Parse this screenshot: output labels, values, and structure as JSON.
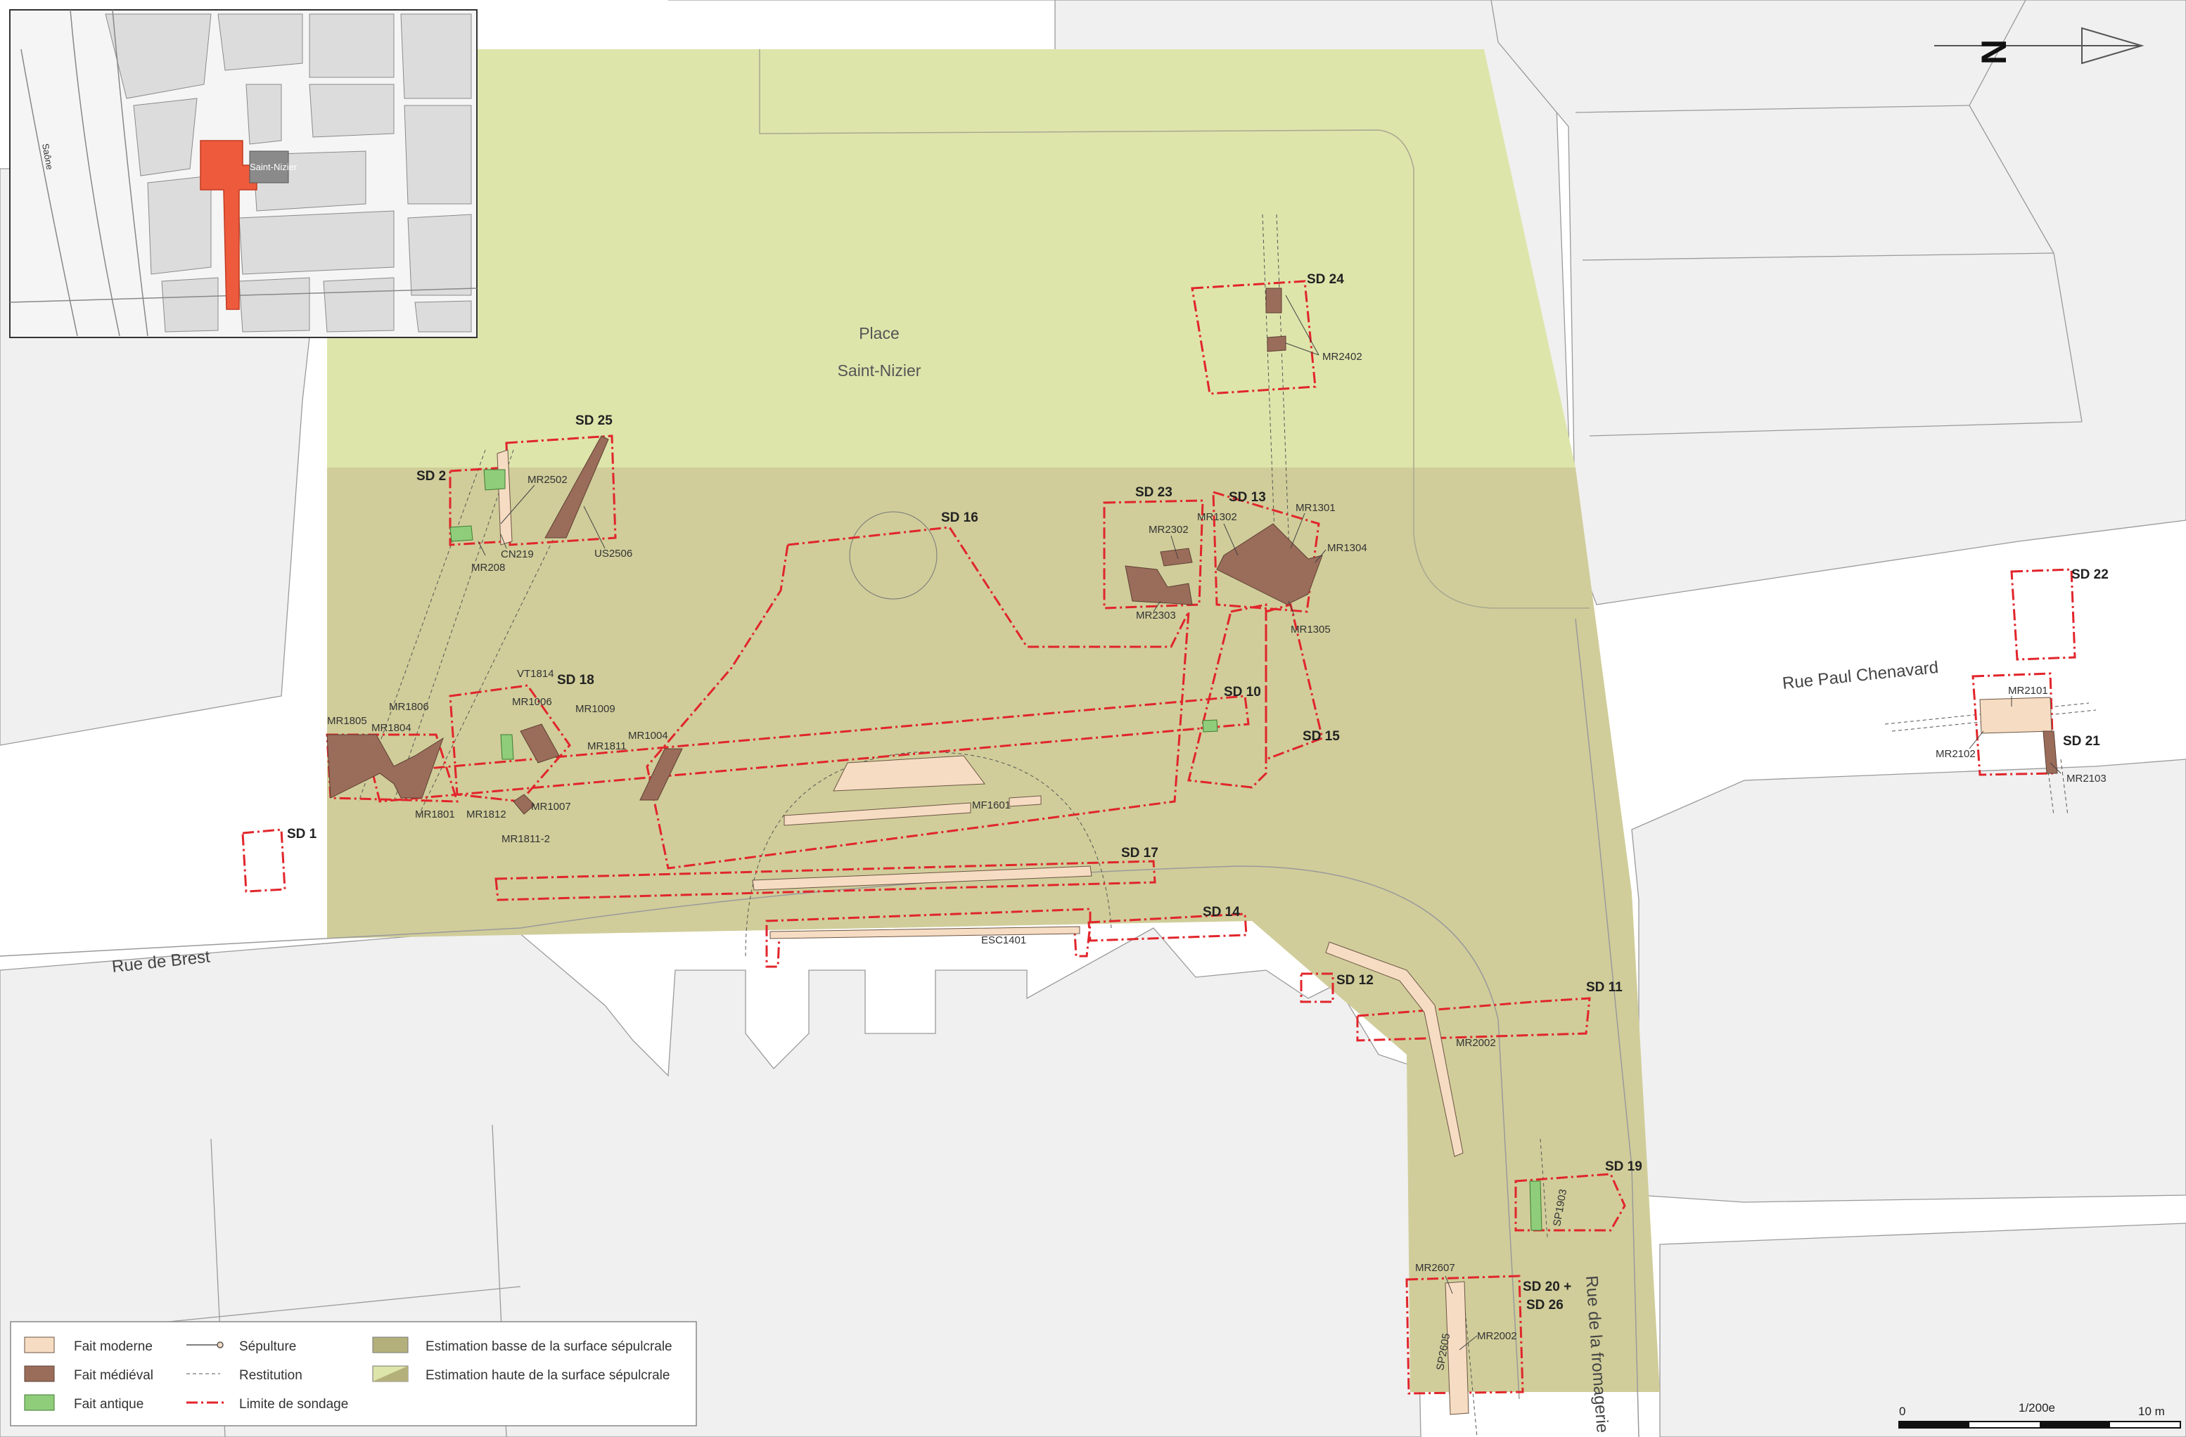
{
  "inset": {
    "church_label": "Saint-Nizier",
    "river_label": "Saône"
  },
  "north": {
    "label": "N"
  },
  "place": {
    "line1": "Place",
    "line2": "Saint-Nizier"
  },
  "streets": {
    "brest": "Rue de Brest",
    "chenavard": "Rue Paul Chenavard",
    "fromagerie": "Rue de la fromagerie"
  },
  "soundings": {
    "sd1": "SD 1",
    "sd2": "SD 2",
    "sd10": "SD 10",
    "sd11": "SD 11",
    "sd12": "SD 12",
    "sd13": "SD 13",
    "sd14": "SD 14",
    "sd15": "SD 15",
    "sd16": "SD 16",
    "sd17": "SD 17",
    "sd18": "SD 18",
    "sd19": "SD 19",
    "sd20a": "SD 20 +",
    "sd20b": "SD 26",
    "sd21": "SD 21",
    "sd22": "SD 22",
    "sd23": "SD 23",
    "sd24": "SD 24",
    "sd25": "SD 25"
  },
  "features": {
    "mr2402": "MR2402",
    "mr2502": "MR2502",
    "cn219": "CN219",
    "mr208": "MR208",
    "us2506": "US2506",
    "mr2302": "MR2302",
    "mr2303": "MR2303",
    "mr1302": "MR1302",
    "mr1301": "MR1301",
    "mr1304": "MR1304",
    "mr1305": "MR1305",
    "vt1814": "VT1814",
    "mr1006": "MR1006",
    "mr1009": "MR1009",
    "mr1811": "MR1811",
    "mr1004": "MR1004",
    "mr1805": "MR1805",
    "mr1806": "MR1806",
    "mr1804": "MR1804",
    "mr1801": "MR1801",
    "mr1812": "MR1812",
    "mr1007": "MR1007",
    "mr1811_2": "MR1811-2",
    "mf1601": "MF1601",
    "esc1401": "ESC1401",
    "mr2002a": "MR2002",
    "mr2002b": "MR2002",
    "sp1903": "SP1903",
    "mr2607": "MR2607",
    "sp2605": "SP2605",
    "mr2101": "MR2101",
    "mr2102": "MR2102",
    "mr2103": "MR2103"
  },
  "legend": {
    "moderne": "Fait moderne",
    "medieval": "Fait médiéval",
    "antique": "Fait antique",
    "sepulture": "Sépulture",
    "restitution": "Restitution",
    "limite": "Limite de sondage",
    "basse": "Estimation basse de la surface sépulcrale",
    "haute": "Estimation haute de la surface sépulcrale"
  },
  "scale": {
    "zero": "0",
    "ratio": "1/200e",
    "end": "10 m"
  },
  "colors": {
    "low_estimate": "#d0cd9a",
    "high_estimate": "#dee5ab",
    "medieval": "#9a6c5a",
    "modern": "#f6dcc2",
    "antique": "#8fcd7a",
    "limit": "#e1252b",
    "highlight": "#ee5a3c"
  }
}
